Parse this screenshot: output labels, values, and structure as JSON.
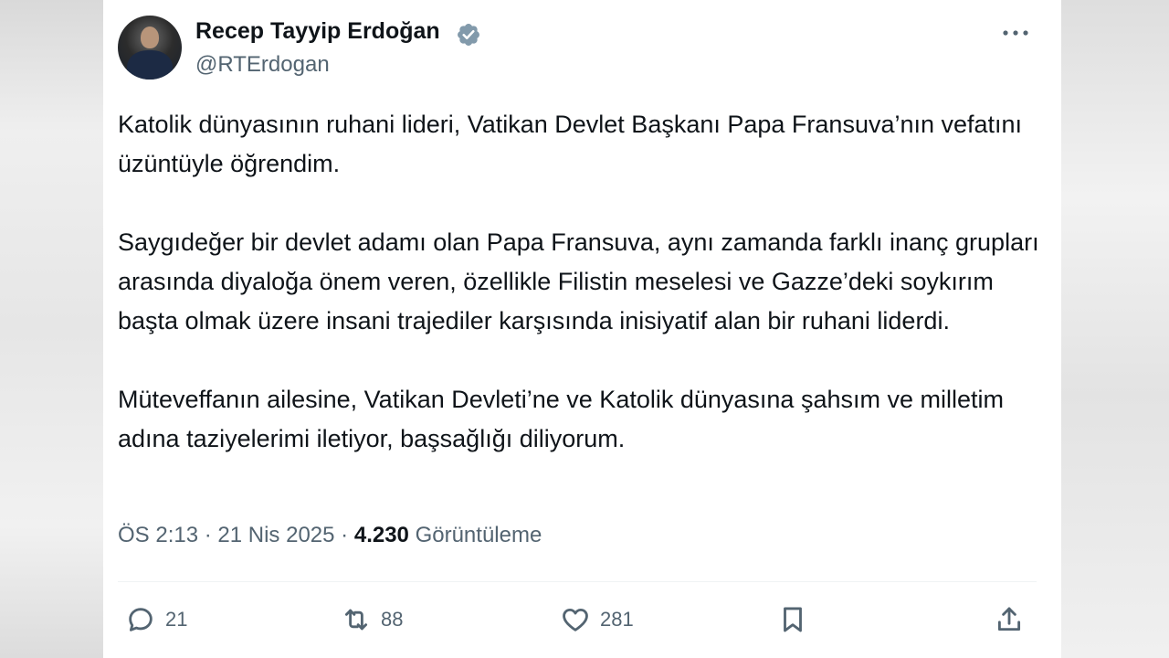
{
  "author": {
    "display_name": "Recep Tayyip Erdoğan",
    "handle": "@RTErdogan",
    "verified_color": "#829aab",
    "avatar_icon": "avatar-photo"
  },
  "tweet": {
    "paragraphs": [
      "Katolik dünyasının ruhani lideri, Vatikan Devlet Başkanı Papa Fransuva’nın vefatını üzüntüyle öğrendim.",
      "Saygıdeğer bir devlet adamı olan Papa Fransuva, aynı zamanda farklı inanç grupları arasında diyaloğa önem veren, özellikle Filistin meselesi ve Gazze’deki soykırım başta olmak üzere insani trajediler karşısında inisiyatif alan bir ruhani liderdi.",
      "Müteveffanın ailesine, Vatikan Devleti’ne ve Katolik dünyasına şahsım ve milletim adına taziyelerimi iletiyor, başsağlığı diliyorum."
    ],
    "time": "ÖS 2:13",
    "separator": "·",
    "date": "21 Nis 2025",
    "views_count": "4.230",
    "views_label": "Görüntüleme"
  },
  "actions": {
    "replies": "21",
    "reposts": "88",
    "likes": "281"
  },
  "colors": {
    "text_primary": "#0f1419",
    "text_secondary": "#536471",
    "divider": "#eff3f4"
  }
}
